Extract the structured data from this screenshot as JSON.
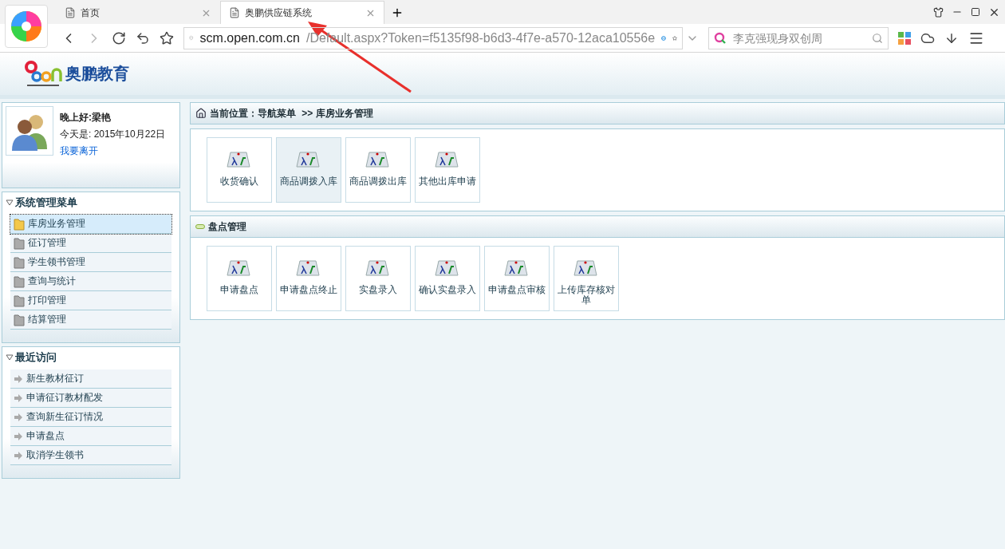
{
  "browser": {
    "tabs": [
      {
        "label": "首页",
        "selected": false
      },
      {
        "label": "奥鹏供应链系统",
        "selected": true
      }
    ],
    "address": {
      "host": "scm.open.com.cn",
      "path": "/Default.aspx?Token=f5135f98-b6d3-4f7e-a570-12aca10556e"
    },
    "search": {
      "placeholder": "李克强现身双创周"
    }
  },
  "header": {
    "logo_text": "奥鹏教育"
  },
  "user": {
    "greeting": "晚上好:",
    "name": "梁艳",
    "date": "今天是: 2015年10月22日",
    "logout": "我要离开"
  },
  "menu": {
    "title": "系统管理菜单",
    "items": [
      {
        "label": "库房业务管理",
        "selected": true
      },
      {
        "label": "征订管理",
        "selected": false
      },
      {
        "label": "学生领书管理",
        "selected": false
      },
      {
        "label": "查询与统计",
        "selected": false
      },
      {
        "label": "打印管理",
        "selected": false
      },
      {
        "label": "结算管理",
        "selected": false
      }
    ]
  },
  "recent": {
    "title": "最近访问",
    "items": [
      "新生教材征订",
      "申请征订教材配发",
      "查询新生征订情况",
      "申请盘点",
      "取消学生领书"
    ]
  },
  "breadcrumb": {
    "prefix": "当前位置：导航菜单",
    "current": ">> 库房业务管理"
  },
  "sections": [
    {
      "tiles": [
        {
          "label": "收货确认",
          "highlighted": false
        },
        {
          "label": "商品调拨入库",
          "highlighted": true
        },
        {
          "label": "商品调拨出库",
          "highlighted": false
        },
        {
          "label": "其他出库申请",
          "highlighted": false
        }
      ]
    },
    {
      "title": "盘点管理",
      "tiles": [
        {
          "label": "申请盘点",
          "highlighted": false
        },
        {
          "label": "申请盘点终止",
          "highlighted": false
        },
        {
          "label": "实盘录入",
          "highlighted": false
        },
        {
          "label": "确认实盘录入",
          "highlighted": false
        },
        {
          "label": "申请盘点审核",
          "highlighted": false
        },
        {
          "label": "上传库存核对单",
          "highlighted": false
        }
      ]
    }
  ]
}
